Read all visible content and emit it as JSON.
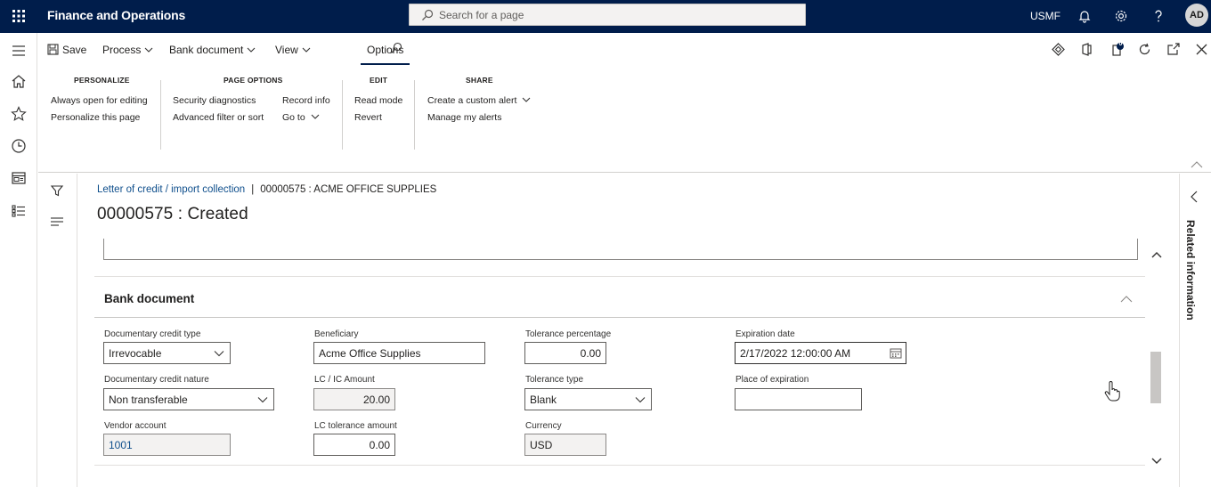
{
  "app": {
    "title": "Finance and Operations",
    "search_placeholder": "Search for a page",
    "company": "USMF",
    "user_initials": "AD"
  },
  "actions": {
    "save": "Save",
    "process": "Process",
    "bank_document": "Bank document",
    "view": "View",
    "options": "Options"
  },
  "ribbon": {
    "personalize": {
      "title": "PERSONALIZE",
      "items": [
        "Always open for editing",
        "Personalize this page"
      ]
    },
    "page_options": {
      "title": "PAGE OPTIONS",
      "items": [
        "Security diagnostics",
        "Advanced filter or sort",
        "Record info",
        "Go to"
      ]
    },
    "edit": {
      "title": "EDIT",
      "items": [
        "Read mode",
        "Revert"
      ]
    },
    "share": {
      "title": "SHARE",
      "items": [
        "Create a custom alert",
        "Manage my alerts"
      ]
    }
  },
  "badge_count": "0",
  "breadcrumb": {
    "link": "Letter of credit / import collection",
    "separator": "|",
    "current": "00000575 : ACME OFFICE SUPPLIES"
  },
  "page_title": "00000575 : Created",
  "section": {
    "title": "Bank document",
    "fields": {
      "doc_credit_type": {
        "label": "Documentary credit type",
        "value": "Irrevocable"
      },
      "doc_credit_nature": {
        "label": "Documentary credit nature",
        "value": "Non transferable"
      },
      "vendor_account": {
        "label": "Vendor account",
        "value": "1001"
      },
      "beneficiary": {
        "label": "Beneficiary",
        "value": "Acme Office Supplies"
      },
      "lc_amount": {
        "label": "LC / IC Amount",
        "value": "20.00"
      },
      "lc_tolerance_amount": {
        "label": "LC tolerance amount",
        "value": "0.00"
      },
      "tolerance_percentage": {
        "label": "Tolerance percentage",
        "value": "0.00"
      },
      "tolerance_type": {
        "label": "Tolerance type",
        "value": "Blank"
      },
      "currency": {
        "label": "Currency",
        "value": "USD"
      },
      "expiration_date": {
        "label": "Expiration date",
        "value": "2/17/2022 12:00:00 AM"
      },
      "place_of_expiration": {
        "label": "Place of expiration",
        "value": ""
      }
    }
  },
  "related_info": "Related information"
}
